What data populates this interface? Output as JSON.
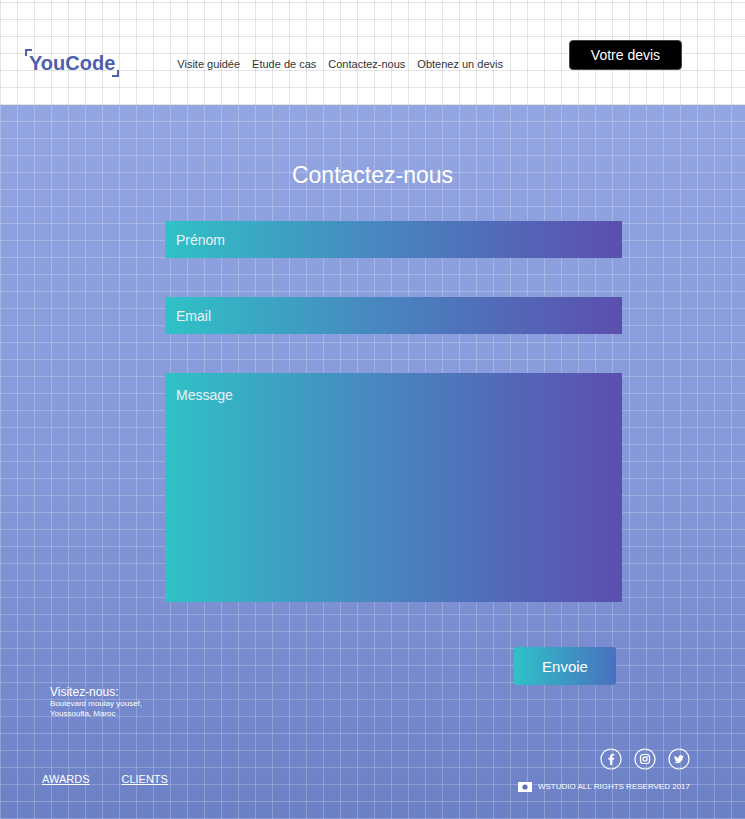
{
  "header": {
    "logo": "YouCode",
    "nav": [
      "Visite guidée",
      "Etude de cas",
      "Contactez-nous",
      "Obtenez un devis"
    ],
    "cta": "Votre devis"
  },
  "contact": {
    "title": "Contactez-nous",
    "fields": [
      {
        "placeholder": "Prénom",
        "kind": "input"
      },
      {
        "placeholder": "Email",
        "kind": "input"
      },
      {
        "placeholder": "Message",
        "kind": "textarea"
      }
    ],
    "submit": "Envoie"
  },
  "footer": {
    "visit_title": "Visitez-nous:",
    "address": [
      "Boulevard moulay yousef,",
      "Youssoufia, Maroc"
    ],
    "links": [
      "AWARDS",
      "CLIENTS"
    ],
    "copyright": "WSTUDIO ALL RIGHTS RESERVED 2017"
  }
}
